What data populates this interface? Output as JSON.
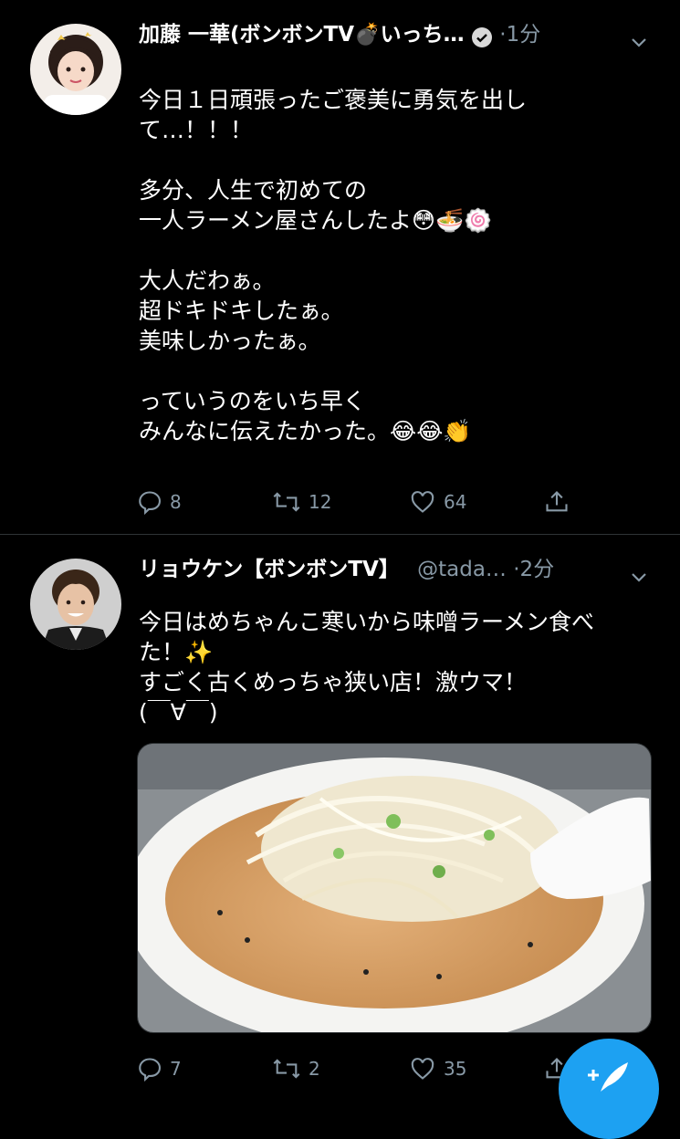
{
  "tweets": [
    {
      "name": "加藤 一華(ボンボンTV💣いっち…",
      "handle": "",
      "time": "·1分",
      "text_lines": [
        "今日１日頑張ったご褒美に勇気を出し",
        "て…！！！",
        "",
        "多分、人生で初めての",
        "一人ラーメン屋さんしたよ😳🍜🍥",
        "",
        "大人だわぁ。",
        "超ドキドキしたぁ。",
        "美味しかったぁ。",
        "",
        "っていうのをいち早く",
        "みんなに伝えたかった。😂😂👏"
      ],
      "replies": "8",
      "retweets": "12",
      "likes": "64",
      "verified": true
    },
    {
      "name": "リョウケン【ボンボンTV】",
      "handle": "@tada…",
      "time": "·2分",
      "text_lines": [
        "今日はめちゃんこ寒いから味噌ラーメン食べ",
        "た！✨",
        "すごく古くめっちゃ狭い店！激ウマ！",
        "(￣∀￣)"
      ],
      "replies": "7",
      "retweets": "2",
      "likes": "35"
    }
  ],
  "colors": {
    "background": "#000000",
    "secondary": "#8899a6",
    "accent": "#1da1f2",
    "divider": "#2f3336"
  },
  "icons": {
    "reply": "reply-icon",
    "retweet": "retweet-icon",
    "like": "heart-icon",
    "share": "share-icon",
    "compose": "compose-icon",
    "more": "chevron-down-icon"
  }
}
